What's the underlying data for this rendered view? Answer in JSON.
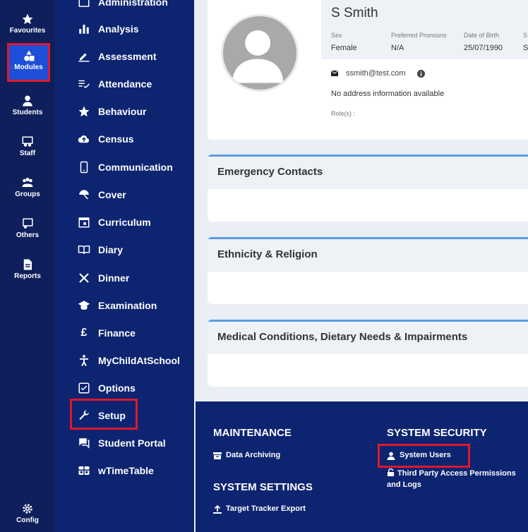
{
  "rail": {
    "items": [
      {
        "label": "Favourites",
        "icon": "star-icon"
      },
      {
        "label": "Modules",
        "icon": "shapes-icon"
      },
      {
        "label": "Students",
        "icon": "person-icon"
      },
      {
        "label": "Staff",
        "icon": "staff-icon"
      },
      {
        "label": "Groups",
        "icon": "group-icon"
      },
      {
        "label": "Others",
        "icon": "others-icon"
      },
      {
        "label": "Reports",
        "icon": "report-icon"
      }
    ],
    "config_label": "Config"
  },
  "menu": {
    "items": [
      {
        "label": "Administration",
        "icon": "briefcase-icon"
      },
      {
        "label": "Analysis",
        "icon": "bar-chart-icon"
      },
      {
        "label": "Assessment",
        "icon": "pen-icon"
      },
      {
        "label": "Attendance",
        "icon": "checklist-icon"
      },
      {
        "label": "Behaviour",
        "icon": "star-icon"
      },
      {
        "label": "Census",
        "icon": "cloud-upload-icon"
      },
      {
        "label": "Communication",
        "icon": "phone-icon"
      },
      {
        "label": "Cover",
        "icon": "umbrella-icon"
      },
      {
        "label": "Curriculum",
        "icon": "calendar-icon"
      },
      {
        "label": "Diary",
        "icon": "book-icon"
      },
      {
        "label": "Dinner",
        "icon": "cutlery-icon"
      },
      {
        "label": "Examination",
        "icon": "graduation-cap-icon"
      },
      {
        "label": "Finance",
        "icon": "pound-icon"
      },
      {
        "label": "MyChildAtSchool",
        "icon": "accessibility-icon"
      },
      {
        "label": "Options",
        "icon": "checkbox-icon"
      },
      {
        "label": "Setup",
        "icon": "wrench-icon"
      },
      {
        "label": "Student Portal",
        "icon": "chat-icon"
      },
      {
        "label": "wTimeTable",
        "icon": "grid-icon"
      }
    ]
  },
  "profile": {
    "name": "S Smith",
    "fields": [
      {
        "label": "Sex",
        "value": "Female"
      },
      {
        "label": "Preferred Pronouns",
        "value": "N/A"
      },
      {
        "label": "Date of Birth",
        "value": "25/07/1990"
      },
      {
        "label": "S",
        "value": "S"
      }
    ],
    "email": "ssmith@test.com",
    "address": "No address information available",
    "roles_label": "Role(s) :"
  },
  "sections": [
    {
      "title": "Emergency Contacts"
    },
    {
      "title": "Ethnicity & Religion"
    },
    {
      "title": "Medical Conditions, Dietary Needs & Impairments"
    }
  ],
  "footer": {
    "maintenance": {
      "title": "MAINTENANCE",
      "links": [
        "Data Archiving"
      ]
    },
    "system_settings": {
      "title": "SYSTEM SETTINGS",
      "links": [
        "Target Tracker Export"
      ]
    },
    "system_security": {
      "title": "SYSTEM SECURITY",
      "links": [
        "System Users",
        "Third Party Access Permissions and Logs"
      ]
    }
  },
  "colors": {
    "highlight": "#e0182b",
    "accent": "#1d4fd8",
    "section_border": "#5b9be0"
  }
}
